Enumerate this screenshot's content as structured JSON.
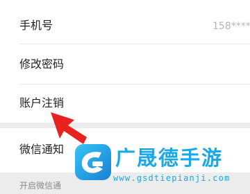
{
  "settings": {
    "items": [
      {
        "label": "手机号",
        "value": "158****"
      },
      {
        "label": "修改密码"
      },
      {
        "label": "账户注销"
      }
    ],
    "wechat_notify": {
      "label": "微信通知",
      "hint": "开启微信通"
    }
  },
  "watermark": {
    "title": "广晟德手游",
    "url": "www.gsdtiepianji.com",
    "color": "#1aa9e6"
  },
  "annotation": {
    "color": "#e8221f",
    "icon": "red-arrow-icon"
  }
}
